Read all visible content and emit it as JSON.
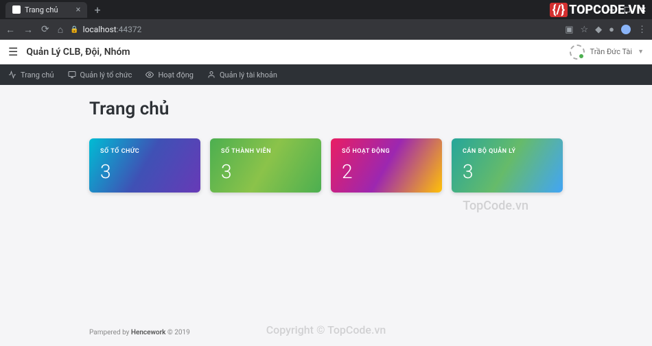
{
  "browser": {
    "tab_title": "Trang chủ",
    "url_host": "localhost",
    "url_port": ":44372"
  },
  "brand_logo": "TOPCODE.VN",
  "header": {
    "app_title": "Quản Lý CLB, Đội, Nhóm",
    "user_name": "Trần Đức Tài"
  },
  "nav": {
    "items": [
      {
        "label": "Trang chủ",
        "icon": "activity"
      },
      {
        "label": "Quản lý tổ chức",
        "icon": "monitor"
      },
      {
        "label": "Hoạt động",
        "icon": "eye"
      },
      {
        "label": "Quản lý tài khoản",
        "icon": "user"
      }
    ]
  },
  "page": {
    "title": "Trang chủ"
  },
  "cards": [
    {
      "label": "SỐ TỔ CHỨC",
      "value": "3"
    },
    {
      "label": "SỐ THÀNH VIÊN",
      "value": "3"
    },
    {
      "label": "SỐ HOẠT ĐỘNG",
      "value": "2"
    },
    {
      "label": "CÁN BỘ QUẢN LÝ",
      "value": "3"
    }
  ],
  "footer": {
    "prefix": "Pampered by ",
    "brand": "Hencework",
    "suffix": " © 2019"
  },
  "watermarks": {
    "wm1": "TopCode.vn",
    "wm2": "Copyright © TopCode.vn"
  }
}
